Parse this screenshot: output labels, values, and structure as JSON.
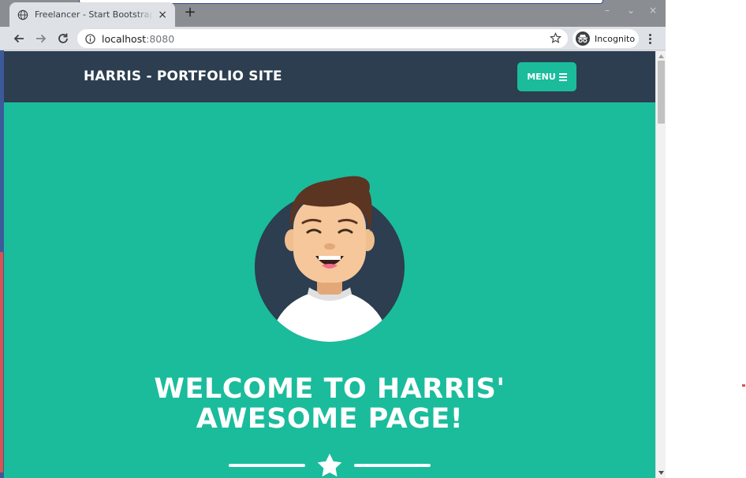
{
  "browser": {
    "tab": {
      "title": "Freelancer - Start Bootstrap Theme",
      "close_label": "×"
    },
    "new_tab_label": "+",
    "window_controls": {
      "minimize": "–",
      "maximize": "⌄",
      "close": "×"
    },
    "address_bar": {
      "host": "localhost",
      "port": ":8080"
    },
    "profile": {
      "label": "Incognito"
    }
  },
  "page": {
    "navbar": {
      "brand": "HARRIS - PORTFOLIO SITE",
      "menu_label": "MENU"
    },
    "hero": {
      "headline_line1": "WELCOME TO HARRIS'",
      "headline_line2": "AWESOME PAGE!"
    }
  },
  "colors": {
    "navbar_bg": "#2c3e50",
    "primary": "#1abc9c",
    "text_light": "#ffffff"
  },
  "icons": [
    "globe-icon",
    "back-icon",
    "forward-icon",
    "reload-icon",
    "info-icon",
    "star-icon",
    "incognito-icon",
    "kebab-icon",
    "hamburger-icon",
    "star-divider-icon"
  ]
}
